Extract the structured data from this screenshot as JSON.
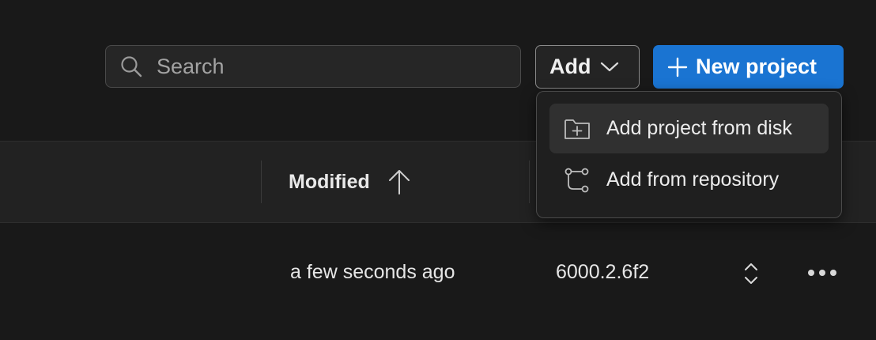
{
  "toolbar": {
    "search": {
      "placeholder": "Search",
      "value": ""
    },
    "add_label": "Add",
    "new_project_label": "New project"
  },
  "dropdown": {
    "items": [
      {
        "label": "Add project from disk",
        "icon": "folder-plus-icon",
        "highlighted": true
      },
      {
        "label": "Add from repository",
        "icon": "git-branch-icon",
        "highlighted": false
      }
    ]
  },
  "table": {
    "columns": {
      "modified": "Modified",
      "modified_sort": "ascending"
    },
    "rows": [
      {
        "modified": "a few seconds ago",
        "version": "6000.2.6f2"
      }
    ]
  },
  "colors": {
    "background": "#191919",
    "accent": "#1a74d2",
    "header_band": "#222222",
    "menu_bg": "#1f1f1f",
    "menu_highlight": "#303030"
  }
}
